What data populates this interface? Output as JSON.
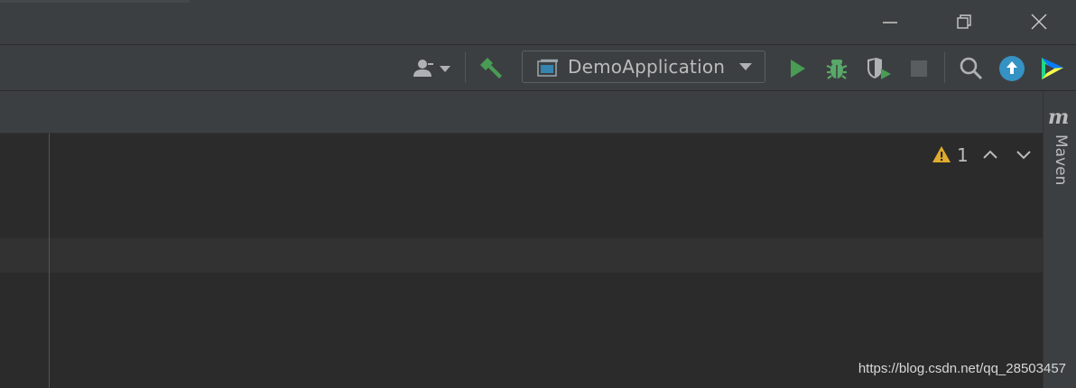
{
  "window_controls": {
    "minimize": "minimize-icon",
    "restore": "restore-icon",
    "close": "close-icon"
  },
  "toolbar": {
    "icons": [
      "user-dropdown-icon",
      "build-hammer-icon",
      "run-icon",
      "debug-icon",
      "coverage-icon",
      "stop-icon",
      "search-icon",
      "update-icon",
      "plugin-icon"
    ],
    "run_config_label": "DemoApplication"
  },
  "editor": {
    "warning_count": "1"
  },
  "right_panel": {
    "maven_label": "Maven"
  },
  "watermark": "https://blog.csdn.net/qq_28503457",
  "colors": {
    "run_green": "#499c54",
    "debug_green": "#59a869",
    "warning_yellow": "#e0ac2e",
    "update_blue": "#3592c4"
  }
}
